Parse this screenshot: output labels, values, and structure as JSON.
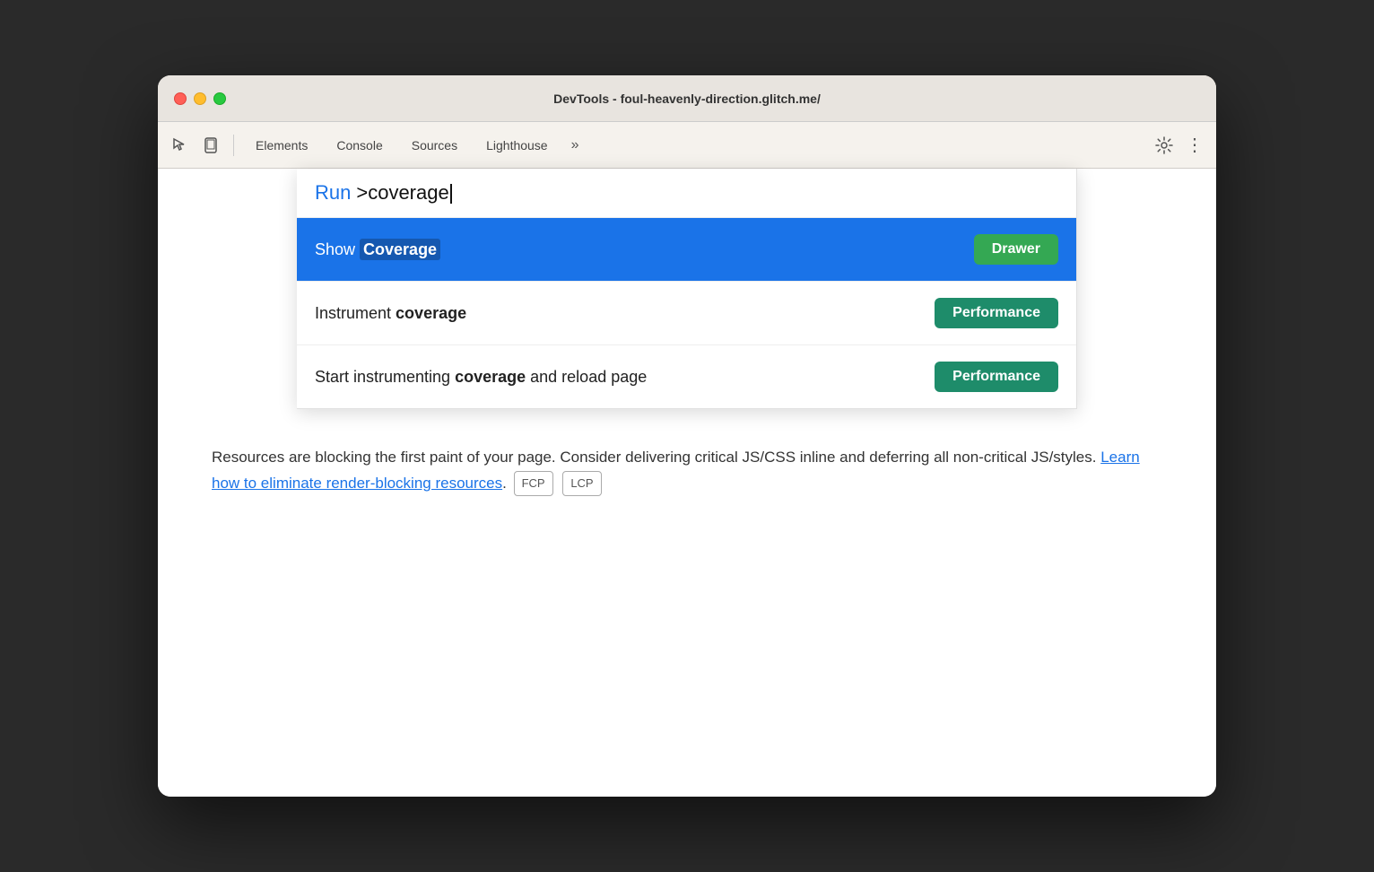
{
  "window": {
    "title": "DevTools - foul-heavenly-direction.glitch.me/"
  },
  "toolbar": {
    "tabs": [
      {
        "id": "elements",
        "label": "Elements"
      },
      {
        "id": "console",
        "label": "Console"
      },
      {
        "id": "sources",
        "label": "Sources"
      },
      {
        "id": "lighthouse",
        "label": "Lighthouse"
      }
    ],
    "more_label": "»"
  },
  "command_palette": {
    "run_label": "Run",
    "input_value": ">coverage",
    "items": [
      {
        "id": "show-coverage",
        "text_plain": "Show",
        "text_highlighted": "Coverage",
        "badge": "Drawer",
        "badge_type": "drawer",
        "highlighted": true
      },
      {
        "id": "instrument-coverage",
        "text_plain": "Instrument",
        "text_highlighted": "coverage",
        "badge": "Performance",
        "badge_type": "performance",
        "highlighted": false
      },
      {
        "id": "start-instrumenting",
        "text_plain": "Start instrumenting",
        "text_highlighted": "coverage",
        "text_suffix": "and reload page",
        "badge": "Performance",
        "badge_type": "performance",
        "highlighted": false
      }
    ]
  },
  "body_content": {
    "description": "Resources are blocking the first paint of your page. Consider delivering critical JS/CSS inline and deferring all non-critical JS/styles.",
    "link_text": "Learn how to eliminate render-blocking resources",
    "link_suffix": ".",
    "badges": [
      "FCP",
      "LCP"
    ]
  },
  "icons": {
    "cursor": "⬚",
    "inspector": "↖",
    "device": "⬜",
    "gear": "⚙",
    "dots": "⋮"
  }
}
